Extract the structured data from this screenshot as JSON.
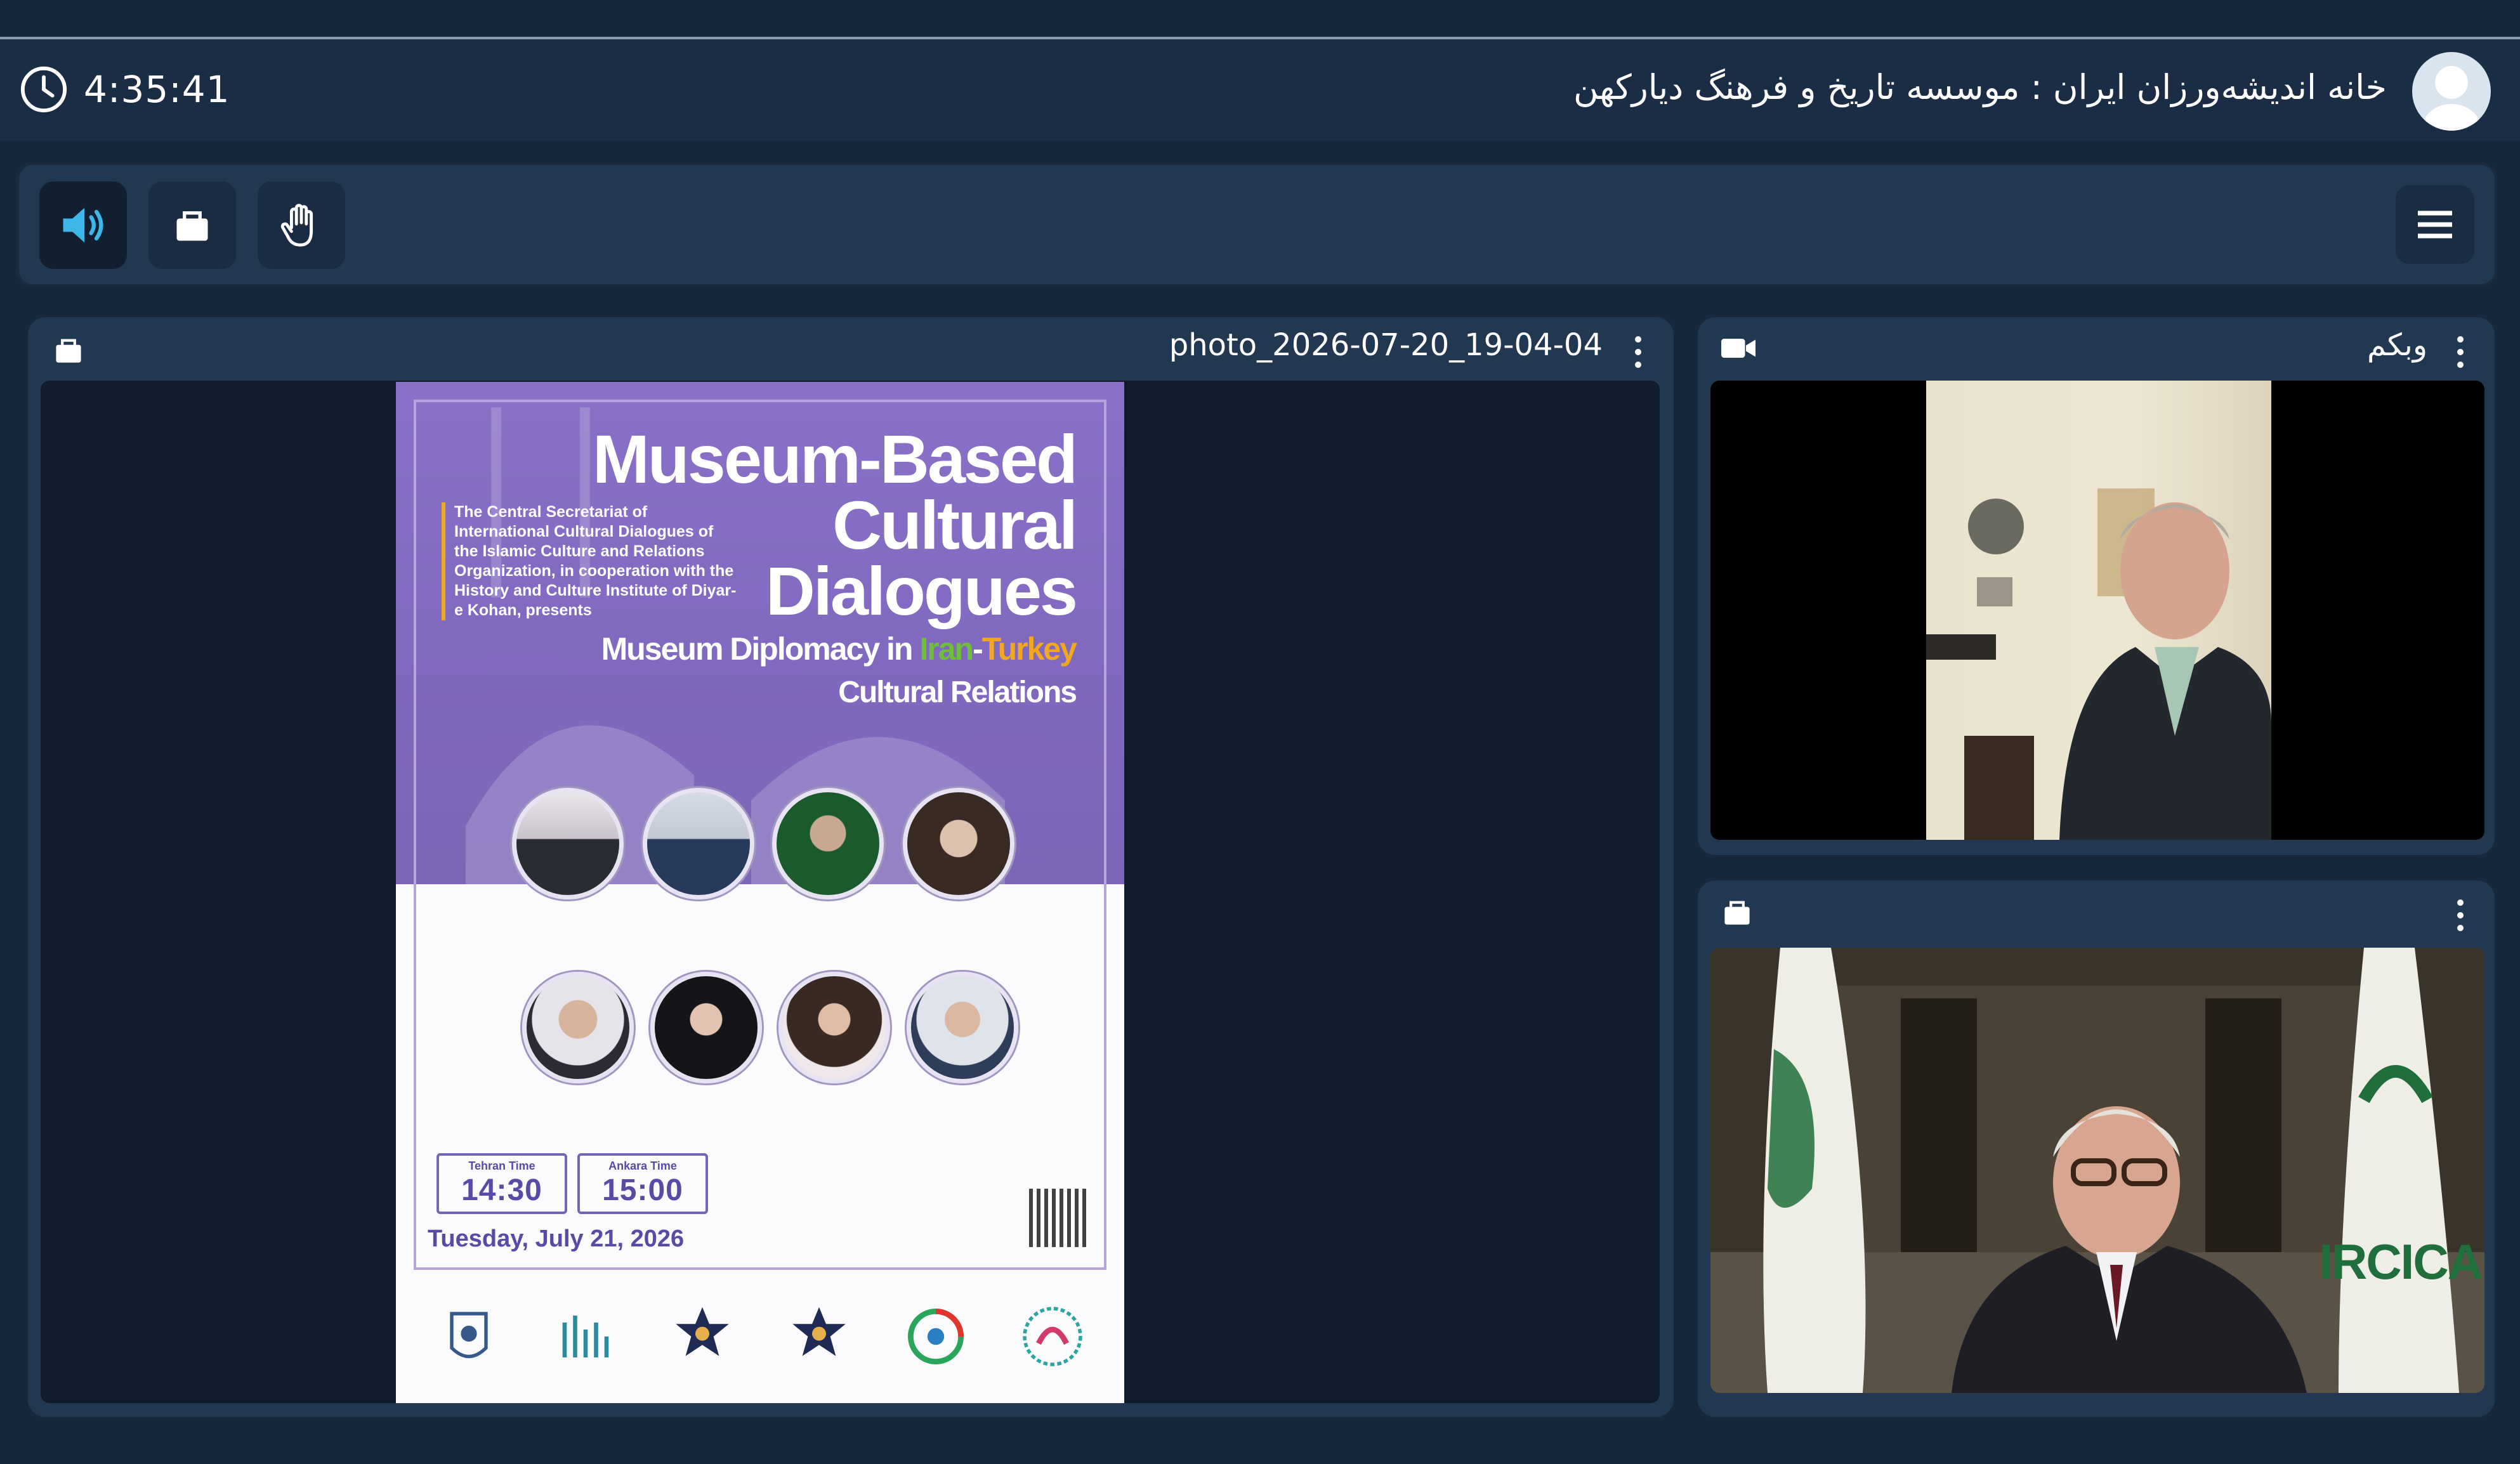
{
  "header": {
    "clock": "4:35:41",
    "room_title": "خانه اندیشه‌ورزان ایران : موسسه تاریخ و فرهنگ دیارکهن"
  },
  "toolbar": {
    "buttons": [
      {
        "name": "speaker",
        "icon": "speaker-icon",
        "active": true
      },
      {
        "name": "screen-share",
        "icon": "share-icon"
      },
      {
        "name": "raise-hand",
        "icon": "hand-icon"
      }
    ],
    "menu_icon": "hamburger-icon"
  },
  "presentation": {
    "title": "photo_2026-07-20_19-04-04",
    "poster": {
      "title": "Museum-Based\nCultural\nDialogues",
      "intro": "The Central Secretariat of International Cultural Dialogues of the Islamic Culture and Relations Organization, in cooperation with the History and Culture Institute of Diyar-e Kohan, presents",
      "subtitle_prefix": "Museum Diplomacy in ",
      "subtitle_iran": "Iran",
      "subtitle_dash": "-",
      "subtitle_turkey": "Turkey",
      "subtitle_line2": "Cultural Relations",
      "time_label_1": "Tehran Time",
      "time_1": "14:30",
      "time_label_2": "Ankara Time",
      "time_2": "15:00",
      "date": "Tuesday, July 21, 2026"
    }
  },
  "webcam_panel": {
    "title": "وبکم",
    "icon": "video-camera-icon"
  },
  "second_panel": {
    "icon": "share-icon",
    "flag_text": "IRCICA"
  },
  "colors": {
    "background": "#17283c",
    "panel": "#223750",
    "speaker_active": "#3fb6e8",
    "poster_purple": "#8a70c8"
  }
}
